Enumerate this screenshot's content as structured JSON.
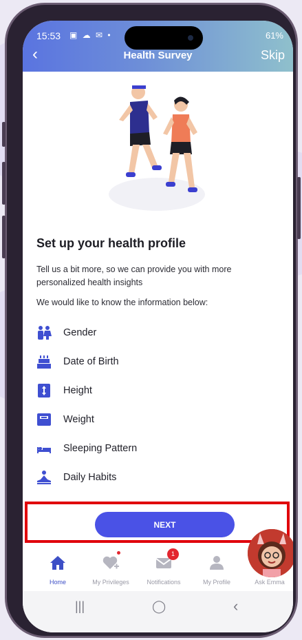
{
  "status_bar": {
    "time": "15:53",
    "icons": "▣ ☁ ✉ •",
    "right": "61%"
  },
  "header": {
    "back_icon": "‹",
    "title": "Health Survey",
    "skip_label": "Skip"
  },
  "intro": {
    "heading": "Set up your health profile",
    "description": "Tell us a bit more, so we can provide you with more personalized health insights",
    "prompt": "We would like to know the information below:"
  },
  "info_items": [
    {
      "label": "Gender",
      "icon": "gender-icon"
    },
    {
      "label": "Date of Birth",
      "icon": "cake-icon"
    },
    {
      "label": "Height",
      "icon": "height-icon"
    },
    {
      "label": "Weight",
      "icon": "scale-icon"
    },
    {
      "label": "Sleeping Pattern",
      "icon": "bed-icon"
    },
    {
      "label": "Daily Habits",
      "icon": "meditation-icon"
    }
  ],
  "next_button": {
    "label": "NEXT"
  },
  "tabs": [
    {
      "label": "Home",
      "icon": "home-icon",
      "active": true
    },
    {
      "label": "My Privileges",
      "icon": "heart-plus-icon",
      "active": false
    },
    {
      "label": "Notifications",
      "icon": "mail-icon",
      "active": false,
      "badge": "1"
    },
    {
      "label": "My Profile",
      "icon": "person-icon",
      "active": false
    },
    {
      "label": "Ask Emma",
      "icon": "emma-avatar-icon",
      "active": false
    }
  ],
  "nav_bar": {
    "recents": "|||",
    "home": "◯",
    "back": "‹"
  },
  "colors": {
    "accent": "#4a52e6",
    "icon_blue": "#3f4fd1",
    "highlight": "#e0000b",
    "header_start": "#5a74e0",
    "header_end": "#8fc0cc"
  }
}
